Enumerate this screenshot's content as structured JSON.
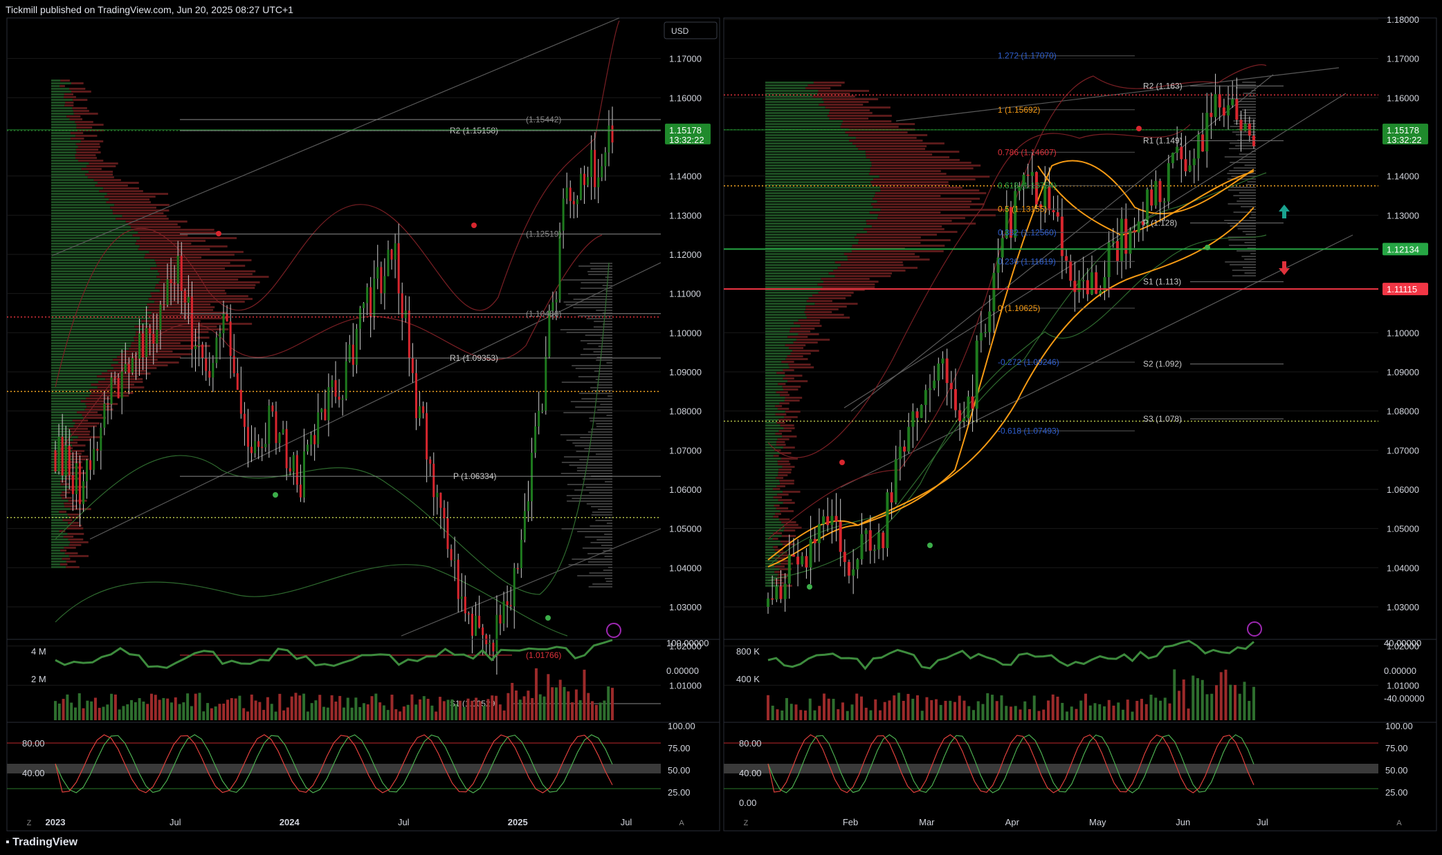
{
  "header": {
    "published": "Tickmill published on TradingView.com, Jun 20, 2025 08:27 UTC+1"
  },
  "footer": {
    "brand": "TradingView"
  },
  "colors": {
    "bull": "#1e7a1e",
    "bear": "#d8262e",
    "bg": "#000000",
    "grid": "#1a1a1a",
    "price_tag": "#1f8a2c",
    "res_tag": "#f23645",
    "sup_tag": "#26a644",
    "ema_orange": "#f59a14"
  },
  "left_panel": {
    "currency": "USD",
    "price_label": "1.15178",
    "countdown": "13:32:22",
    "axis": [
      {
        "v": 1.17,
        "t": "1.17000"
      },
      {
        "v": 1.16,
        "t": "1.16000"
      },
      {
        "v": 1.14,
        "t": "1.14000"
      },
      {
        "v": 1.13,
        "t": "1.13000"
      },
      {
        "v": 1.12,
        "t": "1.12000"
      },
      {
        "v": 1.11,
        "t": "1.11000"
      },
      {
        "v": 1.1,
        "t": "1.10000"
      },
      {
        "v": 1.09,
        "t": "1.09000"
      },
      {
        "v": 1.08,
        "t": "1.08000"
      },
      {
        "v": 1.07,
        "t": "1.07000"
      },
      {
        "v": 1.06,
        "t": "1.06000"
      },
      {
        "v": 1.05,
        "t": "1.05000"
      },
      {
        "v": 1.04,
        "t": "1.04000"
      },
      {
        "v": 1.03,
        "t": "1.03000"
      },
      {
        "v": 1.02,
        "t": "1.02000"
      },
      {
        "v": 1.01,
        "t": "1.01000"
      }
    ],
    "levels": [
      {
        "t": "R2 (1.15158)",
        "v": 1.15158,
        "c": "#c9c9c9"
      },
      {
        "t": "(1.15442)",
        "v": 1.15442,
        "c": "#8a8a8a"
      },
      {
        "t": "(1.12519)",
        "v": 1.12519,
        "c": "#8a8a8a"
      },
      {
        "t": "(1.10486)",
        "v": 1.10486,
        "c": "#8a8a8a"
      },
      {
        "t": "R1 (1.09353)",
        "v": 1.09353,
        "c": "#c9c9c9"
      },
      {
        "t": "P (1.06334)",
        "v": 1.06334,
        "c": "#c9c9c9"
      },
      {
        "t": "(1.01766)",
        "v": 1.01766,
        "c": "#e0323c"
      },
      {
        "t": "S1 (1.00529)",
        "v": 1.00529,
        "c": "#c9c9c9"
      }
    ],
    "x_labels": [
      {
        "t": "2023",
        "f": 0.0
      },
      {
        "t": "Jul",
        "f": 0.21
      },
      {
        "t": "2024",
        "f": 0.41
      },
      {
        "t": "Jul",
        "f": 0.61
      },
      {
        "t": "2025",
        "f": 0.81
      },
      {
        "t": "Jul",
        "f": 1.0
      }
    ],
    "vol_axis": [
      "4 M",
      "2 M"
    ],
    "osc_right": [
      "100.00000",
      "0.00000"
    ],
    "stoch_left": [
      "80.00",
      "40.00"
    ],
    "stoch_right": [
      "100.00",
      "75.00",
      "50.00",
      "25.00"
    ]
  },
  "right_panel": {
    "price_label": "1.15178",
    "countdown": "13:32:22",
    "res_label": "1.11115",
    "sup_label": "1.12134",
    "axis": [
      {
        "v": 1.18,
        "t": "1.18000"
      },
      {
        "v": 1.17,
        "t": "1.17000"
      },
      {
        "v": 1.16,
        "t": "1.16000"
      },
      {
        "v": 1.14,
        "t": "1.14000"
      },
      {
        "v": 1.13,
        "t": "1.13000"
      },
      {
        "v": 1.09,
        "t": "1.09000"
      },
      {
        "v": 1.08,
        "t": "1.08000"
      },
      {
        "v": 1.07,
        "t": "1.07000"
      },
      {
        "v": 1.06,
        "t": "1.06000"
      },
      {
        "v": 1.05,
        "t": "1.05000"
      },
      {
        "v": 1.04,
        "t": "1.04000"
      },
      {
        "v": 1.03,
        "t": "1.03000"
      },
      {
        "v": 1.02,
        "t": "1.02000"
      },
      {
        "v": 1.01,
        "t": "1.01000"
      },
      {
        "v": 1.1,
        "t": "1.10000"
      }
    ],
    "fib": [
      {
        "t": "1.272 (1.17070)",
        "v": 1.1707,
        "c": "#2f5fd0"
      },
      {
        "t": "1 (1.15692)",
        "v": 1.15692,
        "c": "#f59a14"
      },
      {
        "t": "0.786 (1.14607)",
        "v": 1.14607,
        "c": "#e0323c"
      },
      {
        "t": "0.618 (1.13754)",
        "v": 1.13754,
        "c": "#2aa040"
      },
      {
        "t": "0.5 (1.13155)",
        "v": 1.13155,
        "c": "#f59a14"
      },
      {
        "t": "0.382 (1.12560)",
        "v": 1.1256,
        "c": "#2f5fd0"
      },
      {
        "t": "0.236 (1.11819)",
        "v": 1.11819,
        "c": "#2f5fd0"
      },
      {
        "t": "0 (1.10625)",
        "v": 1.10625,
        "c": "#f59a14"
      },
      {
        "t": "-0.272 (1.09246)",
        "v": 1.09246,
        "c": "#2f5fd0"
      },
      {
        "t": "-0.618 (1.07493)",
        "v": 1.07493,
        "c": "#2f5fd0"
      }
    ],
    "pivots": [
      {
        "t": "R2 (1.163)",
        "v": 1.163
      },
      {
        "t": "R1 (1.149)",
        "v": 1.149
      },
      {
        "t": "P (1.128)",
        "v": 1.128
      },
      {
        "t": "S1 (1.113)",
        "v": 1.113
      },
      {
        "t": "S2 (1.092)",
        "v": 1.092
      },
      {
        "t": "S3 (1.078)",
        "v": 1.078
      }
    ],
    "x_labels": [
      {
        "t": "Feb",
        "f": 0.135
      },
      {
        "t": "Mar",
        "f": 0.26
      },
      {
        "t": "Apr",
        "f": 0.4
      },
      {
        "t": "May",
        "f": 0.54
      },
      {
        "t": "Jun",
        "f": 0.68
      },
      {
        "t": "Jul",
        "f": 0.81
      }
    ],
    "vol_axis": [
      "800 K",
      "400 K"
    ],
    "osc_right": [
      "40.00000",
      "0.00000",
      "-40.00000"
    ],
    "stoch_left": [
      "80.00",
      "40.00",
      "0.00"
    ],
    "stoch_right": [
      "100.00",
      "75.00",
      "50.00",
      "25.00"
    ]
  },
  "chart_data": [
    {
      "type": "line",
      "title": "",
      "series": [
        {
          "name": "",
          "values": [
            1.07,
            1.06,
            1.08,
            1.09,
            1.1,
            1.12,
            1.09,
            1.1,
            1.07,
            1.08,
            1.06,
            1.08,
            1.09,
            1.11,
            1.12,
            1.08,
            1.05,
            1.03,
            1.02,
            1.04,
            1.08,
            1.13,
            1.14,
            1.15
          ]
        }
      ],
      "ylim": [
        1.0,
        1.18
      ]
    },
    {
      "type": "line",
      "title": "",
      "series": [
        {
          "name": "",
          "values": [
            1.03,
            1.04,
            1.05,
            1.04,
            1.05,
            1.08,
            1.09,
            1.08,
            1.12,
            1.14,
            1.13,
            1.11,
            1.12,
            1.13,
            1.14,
            1.15,
            1.16,
            1.15
          ]
        }
      ],
      "ylim": [
        1.0,
        1.18
      ]
    }
  ]
}
